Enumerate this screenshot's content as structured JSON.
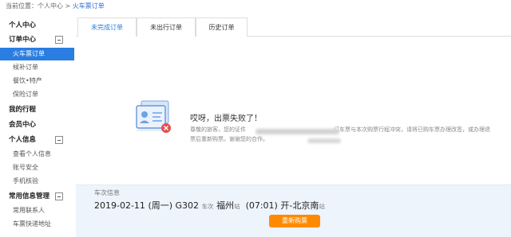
{
  "breadcrumb": {
    "prefix": "当前位置：",
    "parent": "个人中心",
    "sep": ">",
    "current": "火车票订单"
  },
  "sidebar": {
    "sections": [
      {
        "title": "个人中心",
        "collapsible": false,
        "items": []
      },
      {
        "title": "订单中心",
        "collapsible": true,
        "items": [
          "火车票订单",
          "候补订单",
          "餐饮•特产",
          "保险订单"
        ],
        "active": "火车票订单"
      },
      {
        "title": "我的行程",
        "collapsible": false,
        "items": []
      },
      {
        "title": "会员中心",
        "collapsible": false,
        "items": []
      },
      {
        "title": "个人信息",
        "collapsible": true,
        "items": [
          "查看个人信息",
          "账号安全",
          "手机核验"
        ]
      },
      {
        "title": "常用信息管理",
        "collapsible": true,
        "items": [
          "常用联系人",
          "车票快递地址"
        ]
      }
    ]
  },
  "tabs": [
    {
      "label": "未完成订单",
      "active": true
    },
    {
      "label": "未出行订单",
      "active": false
    },
    {
      "label": "历史订单",
      "active": false
    }
  ],
  "message": {
    "title": "哎呀，出票失败了！",
    "desc_part1": "尊敬的旅客，您的证件",
    "desc_part2": "订车票与本次购票行程冲突，请将已购车票办理改签，或办理退票后重新购票。谢谢您的合作。"
  },
  "trip": {
    "label": "车次信息",
    "date": "2019-02-11",
    "weekday": "(周一)",
    "train_no": "G302",
    "train_suffix": "车次",
    "from": "福州",
    "station_suffix": "站",
    "depart_time": "(07:01)",
    "depart_label": "开",
    "arrow": "-",
    "to": "北京南",
    "to_suffix": "站"
  },
  "actions": {
    "rebuy": "重新购票"
  },
  "colors": {
    "accent": "#2a7de1",
    "orange": "#ff8a00",
    "info_bg": "#edf4fc"
  }
}
